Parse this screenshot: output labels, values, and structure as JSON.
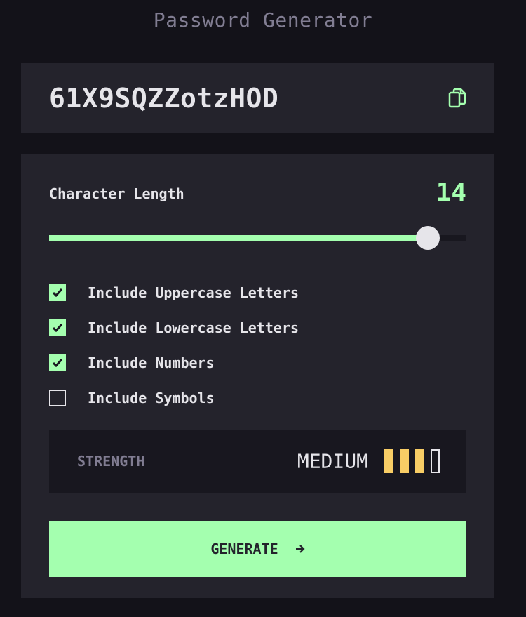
{
  "header": {
    "title": "Password Generator"
  },
  "password": {
    "value": "61X9SQZZotzHOD",
    "copy_icon": "copy-icon"
  },
  "length": {
    "label": "Character Length",
    "value": "14",
    "slider_fraction": 0.907
  },
  "options": [
    {
      "label": "Include Uppercase Letters",
      "checked": true
    },
    {
      "label": "Include Lowercase Letters",
      "checked": true
    },
    {
      "label": "Include Numbers",
      "checked": true
    },
    {
      "label": "Include Symbols",
      "checked": false
    }
  ],
  "strength": {
    "label": "STRENGTH",
    "value": "MEDIUM",
    "level": 3,
    "max_level": 4
  },
  "generate": {
    "label": "GENERATE",
    "icon": "arrow-right-icon"
  },
  "colors": {
    "background": "#131219",
    "panel": "#24232C",
    "accent": "#A4FFAF",
    "text": "#E6E5EA",
    "muted": "#817D92",
    "strength_medium": "#F8CD65"
  }
}
